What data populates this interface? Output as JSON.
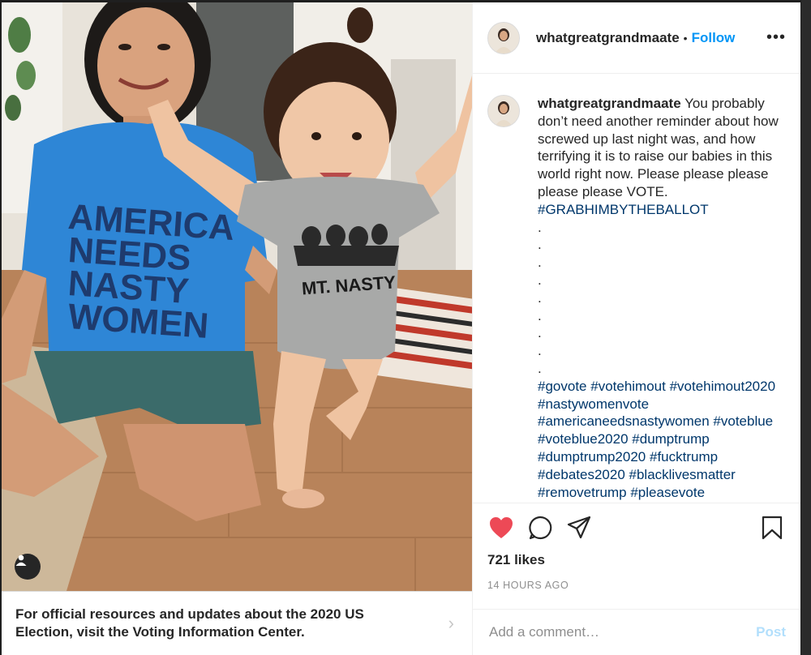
{
  "post": {
    "username": "whatgreatgrandmaate",
    "follow_label": "Follow",
    "header_separator": "•",
    "more_label": "•••",
    "caption": {
      "username": "whatgreatgrandmaate",
      "text": "You probably don’t need another reminder about how screwed up last night was, and how terrifying it is to raise our babies in this world right now. Please please please please please VOTE.",
      "first_hashtag": "#GRABHIMBYTHEBALLOT",
      "dots": [
        ".",
        ".",
        ".",
        ".",
        ".",
        ".",
        ".",
        ".",
        "."
      ],
      "hashtags": [
        "#govote",
        "#votehimout",
        "#votehimout2020",
        "#nastywomenvote",
        "#americaneedsnastywomen",
        "#voteblue",
        "#voteblue2020",
        "#dumptrump",
        "#dumptrump2020",
        "#fucktrump",
        "#debates2020",
        "#blacklivesmatter",
        "#removetrump",
        "#pleasevote"
      ]
    },
    "likes": "721 likes",
    "timestamp": "14 HOURS AGO",
    "comment_placeholder": "Add a comment…",
    "post_label": "Post"
  },
  "photo": {
    "shirt_text_lines": [
      "AMERICA",
      "NEEDS",
      "NASTY",
      "WOMEN"
    ],
    "onesie_text": "MT. NASTY"
  },
  "banner": {
    "text": "For official resources and updates about the 2020 US Election, visit the Voting Information Center.",
    "chevron": "›"
  },
  "colors": {
    "accent": "#0095f6",
    "like_red": "#ed4956",
    "hashtag": "#00376b"
  },
  "icons": [
    "heart-icon",
    "comment-icon",
    "share-icon",
    "bookmark-icon",
    "user-tag-icon",
    "more-icon"
  ]
}
